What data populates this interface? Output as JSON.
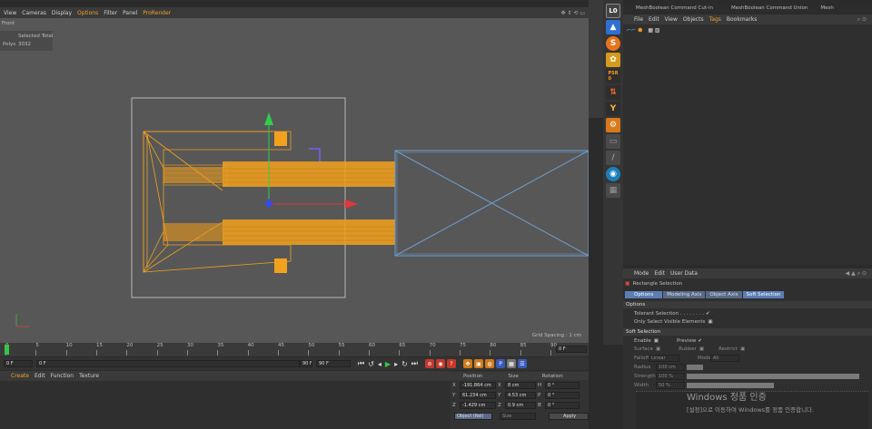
{
  "viewport": {
    "menu": [
      "View",
      "Cameras",
      "Display",
      "Options",
      "Filter",
      "Panel",
      "ProRender"
    ],
    "active_menu": "Options",
    "label": "Front",
    "stats_header": "Selected Total",
    "stats_label": "Polys",
    "stats_value": "3032",
    "grid_spacing": "Grid Spacing : 1 cm"
  },
  "object_manager": {
    "tabs": [
      "MeshBoolean Command Cut-in",
      "MeshBoolean Command Union",
      "Mesh"
    ],
    "menu": [
      "File",
      "Edit",
      "View",
      "Objects",
      "Tags",
      "Bookmarks"
    ],
    "active_menu": "Tags"
  },
  "attributes": {
    "menu": [
      "Mode",
      "Edit",
      "User Data"
    ],
    "title": "Rectangle Selection",
    "tabs": [
      "Options",
      "Modeling Axis",
      "Object Axis",
      "Soft Selection"
    ],
    "options_header": "Options",
    "tolerant": "Tolerant Selection . . . . . . . .",
    "tolerant_check": "✔",
    "only_visible": "Only Select Visible Elements",
    "soft_header": "Soft Selection",
    "enable": "Enable",
    "preview": "Preview",
    "preview_check": "✔",
    "surface": "Surface",
    "rubber": "Rubber",
    "restrict": "Restrict",
    "falloff": "Falloff",
    "falloff_value": "Linear",
    "mode": "Mode",
    "mode_value": "All",
    "radius": "Radius",
    "radius_value": "100 cm",
    "strength": "Strength",
    "strength_value": "100 %",
    "width": "Width",
    "width_value": "50 %"
  },
  "watermark": {
    "title": "Windows 정품 인증",
    "subtitle": "[설정]으로 이동하여 Windows를 정품 인증합니다."
  },
  "timeline": {
    "ticks": [
      "0",
      "5",
      "10",
      "15",
      "20",
      "25",
      "30",
      "35",
      "40",
      "45",
      "50",
      "55",
      "60",
      "65",
      "70",
      "75",
      "80",
      "85",
      "90"
    ],
    "current_frame": "0 F",
    "start": "0 F",
    "start2": "0 F",
    "end": "90 F",
    "end2": "90 F"
  },
  "material_menu": [
    "Create",
    "Edit",
    "Function",
    "Texture"
  ],
  "coords": {
    "headers": [
      "Position",
      "Size",
      "Rotation"
    ],
    "rows": [
      {
        "axis": "X",
        "pos": "-191.864 cm",
        "saxis": "X",
        "size": "8 cm",
        "raxis": "H",
        "rot": "0 °"
      },
      {
        "axis": "Y",
        "pos": "61.234 cm",
        "saxis": "Y",
        "size": "4.53 cm",
        "raxis": "P",
        "rot": "0 °"
      },
      {
        "axis": "Z",
        "pos": "-1.429 cm",
        "saxis": "Z",
        "size": "0.9 cm",
        "raxis": "B",
        "rot": "0 °"
      }
    ],
    "mode": "Object (Rel)",
    "size_mode": "Size",
    "apply": "Apply"
  },
  "colors": {
    "orange": "#f2a11d",
    "blue": "#6e9ecf",
    "accent": "#5b7db4"
  }
}
